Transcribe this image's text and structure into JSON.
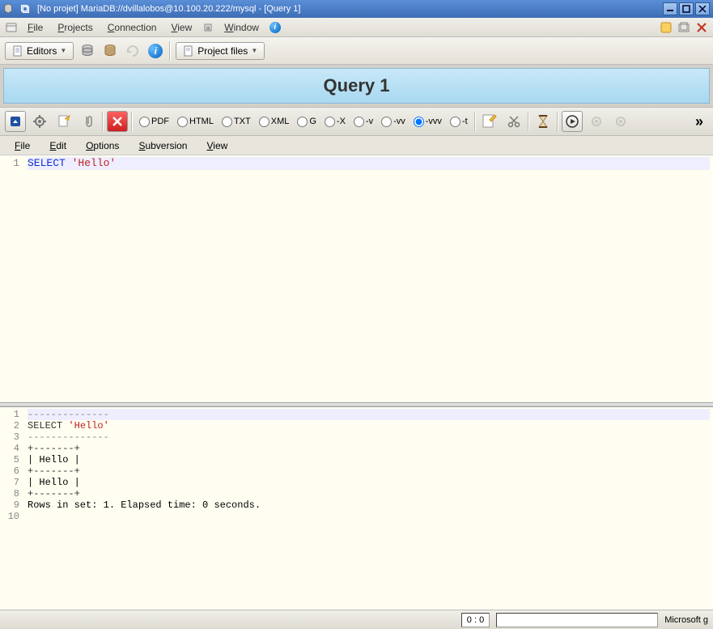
{
  "window": {
    "title": "[No projet] MariaDB://dvillalobos@10.100.20.222/mysql - [Query 1]"
  },
  "menubar": {
    "file": "File",
    "projects": "Projects",
    "connection": "Connection",
    "view": "View",
    "window": "Window"
  },
  "toolbar1": {
    "editors": "Editors",
    "project_files": "Project files"
  },
  "query_header": "Query 1",
  "toolbar2_radios": {
    "pdf": "PDF",
    "html": "HTML",
    "txt": "TXT",
    "xml": "XML",
    "g": "G",
    "x": "-X",
    "v": "-v",
    "vv": "-vv",
    "vvv": "-vvv",
    "vvv_selected": true,
    "t": "-t"
  },
  "overflow": "»",
  "editor_menu": {
    "file": "File",
    "edit": "Edit",
    "options": "Options",
    "subversion": "Subversion",
    "view": "View"
  },
  "editor": {
    "line_no": "1",
    "keyword": "SELECT",
    "string": "'Hello'"
  },
  "output": {
    "lines": [
      "1",
      "2",
      "3",
      "4",
      "5",
      "6",
      "7",
      "8",
      "9",
      "10"
    ],
    "dashes": "--------------",
    "select": "SELECT ",
    "str": "'Hello'",
    "d3": "--------------",
    "border": "+-------+",
    "row": "| Hello |",
    "summary": "Rows in set: 1. Elapsed time: 0 seconds."
  },
  "status": {
    "cursor": "0 : 0",
    "input_value": "",
    "right": "Microsoft g"
  }
}
